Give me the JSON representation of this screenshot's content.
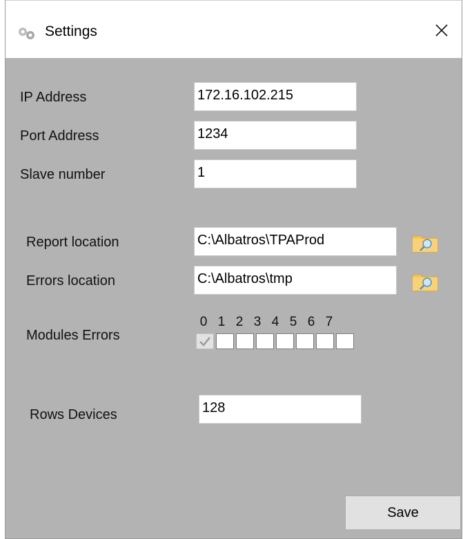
{
  "window": {
    "title": "Settings",
    "icon": "gears-icon",
    "close_glyph": "✕"
  },
  "form": {
    "ip": {
      "label": "IP Address",
      "value": "172.16.102.215"
    },
    "port": {
      "label": "Port Address",
      "value": "1234"
    },
    "slave": {
      "label": "Slave number",
      "value": "1"
    },
    "report": {
      "label": "Report location",
      "value": "C:\\Albatros\\TPAProd",
      "browse_icon": "folder-search-icon"
    },
    "errors": {
      "label": "Errors location",
      "value": "C:\\Albatros\\tmp",
      "browse_icon": "folder-search-icon"
    },
    "modules": {
      "label": "Modules Errors",
      "bits": [
        "0",
        "1",
        "2",
        "3",
        "4",
        "5",
        "6",
        "7"
      ],
      "checked": [
        true,
        false,
        false,
        false,
        false,
        false,
        false,
        false
      ]
    },
    "rows": {
      "label": "Rows Devices",
      "value": "128"
    }
  },
  "buttons": {
    "save": "Save"
  },
  "colors": {
    "window_bg": "#b3b3b3",
    "titlebar_bg": "#ffffff",
    "folder": "#f5c55a"
  }
}
